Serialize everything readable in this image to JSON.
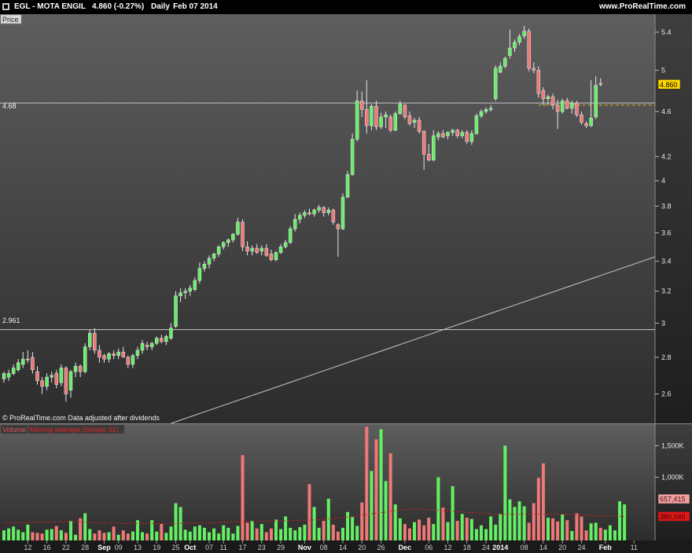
{
  "header": {
    "ticker": "EGL - MOTA ENGIL",
    "quote": "4.860 (-0.27%)",
    "period": "Daily",
    "date": "Feb 07 2014",
    "website": "www.ProRealTime.com"
  },
  "price_panel": {
    "label": "Price",
    "footer": "© ProRealTime.com  Data adjusted after dividends",
    "hline_labels": [
      "4.68",
      "2.961"
    ]
  },
  "volume_panel": {
    "label": "Volume",
    "ma_label": "Moving average (Simple 31)"
  },
  "colors": {
    "up": "#64f064",
    "down": "#f07878",
    "grid": "#c8c8c8",
    "ma": "#cc2222",
    "price_badge": "#ffd700",
    "volume_badge": "#f0a0a0",
    "ma_badge": "#e01818"
  },
  "chart_data": [
    {
      "type": "candlestick",
      "title": "EGL - MOTA ENGIL",
      "period": "Daily",
      "y_scale": "log",
      "ylim": [
        2.45,
        5.6
      ],
      "y_ticks": [
        2.6,
        2.8,
        3,
        3.2,
        3.4,
        3.6,
        3.8,
        4,
        4.2,
        4.6,
        5,
        5.4
      ],
      "x_ticks": [
        "12",
        "16",
        "22",
        "28",
        "Sep",
        "09",
        "13",
        "19",
        "25",
        "Oct",
        "07",
        "11",
        "17",
        "23",
        "29",
        "Nov",
        "08",
        "14",
        "20",
        "26",
        "Dec",
        "06",
        "12",
        "18",
        "24",
        "2014",
        "08",
        "14",
        "20",
        "24",
        "Feb",
        "11"
      ],
      "x_ticks_bold": [
        "Sep",
        "Oct",
        "Nov",
        "Dec",
        "2014",
        "Feb"
      ],
      "horizontal_lines": [
        4.68,
        2.961
      ],
      "trendline": {
        "start": [
          "Oct 11",
          2.45
        ],
        "end": [
          "Feb 12",
          3.43
        ]
      },
      "last_price": 4.86,
      "dashed_level": 4.66,
      "series": [
        {
          "o": 2.68,
          "h": 2.72,
          "l": 2.66,
          "c": 2.71
        },
        {
          "o": 2.69,
          "h": 2.73,
          "l": 2.67,
          "c": 2.71
        },
        {
          "o": 2.71,
          "h": 2.76,
          "l": 2.7,
          "c": 2.74
        },
        {
          "o": 2.73,
          "h": 2.79,
          "l": 2.72,
          "c": 2.77
        },
        {
          "o": 2.76,
          "h": 2.83,
          "l": 2.74,
          "c": 2.79
        },
        {
          "o": 2.79,
          "h": 2.84,
          "l": 2.77,
          "c": 2.79
        },
        {
          "o": 2.8,
          "h": 2.83,
          "l": 2.71,
          "c": 2.73
        },
        {
          "o": 2.72,
          "h": 2.75,
          "l": 2.65,
          "c": 2.67
        },
        {
          "o": 2.67,
          "h": 2.69,
          "l": 2.6,
          "c": 2.64
        },
        {
          "o": 2.64,
          "h": 2.71,
          "l": 2.62,
          "c": 2.69
        },
        {
          "o": 2.69,
          "h": 2.72,
          "l": 2.66,
          "c": 2.7
        },
        {
          "o": 2.71,
          "h": 2.73,
          "l": 2.63,
          "c": 2.65
        },
        {
          "o": 2.66,
          "h": 2.76,
          "l": 2.64,
          "c": 2.74
        },
        {
          "o": 2.74,
          "h": 2.75,
          "l": 2.56,
          "c": 2.6
        },
        {
          "o": 2.62,
          "h": 2.73,
          "l": 2.58,
          "c": 2.72
        },
        {
          "o": 2.72,
          "h": 2.77,
          "l": 2.69,
          "c": 2.75
        },
        {
          "o": 2.75,
          "h": 2.76,
          "l": 2.69,
          "c": 2.72
        },
        {
          "o": 2.72,
          "h": 2.88,
          "l": 2.71,
          "c": 2.86
        },
        {
          "o": 2.86,
          "h": 2.96,
          "l": 2.84,
          "c": 2.94
        },
        {
          "o": 2.94,
          "h": 2.97,
          "l": 2.82,
          "c": 2.84
        },
        {
          "o": 2.84,
          "h": 2.87,
          "l": 2.77,
          "c": 2.8
        },
        {
          "o": 2.81,
          "h": 2.82,
          "l": 2.77,
          "c": 2.79
        },
        {
          "o": 2.79,
          "h": 2.83,
          "l": 2.77,
          "c": 2.82
        },
        {
          "o": 2.82,
          "h": 2.84,
          "l": 2.79,
          "c": 2.81
        },
        {
          "o": 2.81,
          "h": 2.85,
          "l": 2.79,
          "c": 2.83
        },
        {
          "o": 2.83,
          "h": 2.86,
          "l": 2.8,
          "c": 2.8
        },
        {
          "o": 2.8,
          "h": 2.81,
          "l": 2.74,
          "c": 2.76
        },
        {
          "o": 2.76,
          "h": 2.82,
          "l": 2.74,
          "c": 2.81
        },
        {
          "o": 2.81,
          "h": 2.86,
          "l": 2.79,
          "c": 2.84
        },
        {
          "o": 2.84,
          "h": 2.9,
          "l": 2.82,
          "c": 2.88
        },
        {
          "o": 2.87,
          "h": 2.89,
          "l": 2.84,
          "c": 2.86
        },
        {
          "o": 2.86,
          "h": 2.89,
          "l": 2.84,
          "c": 2.88
        },
        {
          "o": 2.88,
          "h": 2.92,
          "l": 2.87,
          "c": 2.91
        },
        {
          "o": 2.91,
          "h": 2.93,
          "l": 2.88,
          "c": 2.89
        },
        {
          "o": 2.89,
          "h": 2.93,
          "l": 2.87,
          "c": 2.92
        },
        {
          "o": 2.91,
          "h": 3.0,
          "l": 2.9,
          "c": 2.97
        },
        {
          "o": 2.98,
          "h": 3.2,
          "l": 2.97,
          "c": 3.17
        },
        {
          "o": 3.17,
          "h": 3.22,
          "l": 3.13,
          "c": 3.19
        },
        {
          "o": 3.19,
          "h": 3.22,
          "l": 3.15,
          "c": 3.2
        },
        {
          "o": 3.2,
          "h": 3.24,
          "l": 3.17,
          "c": 3.22
        },
        {
          "o": 3.21,
          "h": 3.29,
          "l": 3.2,
          "c": 3.27
        },
        {
          "o": 3.27,
          "h": 3.39,
          "l": 3.25,
          "c": 3.35
        },
        {
          "o": 3.35,
          "h": 3.4,
          "l": 3.33,
          "c": 3.38
        },
        {
          "o": 3.38,
          "h": 3.44,
          "l": 3.35,
          "c": 3.42
        },
        {
          "o": 3.42,
          "h": 3.46,
          "l": 3.4,
          "c": 3.45
        },
        {
          "o": 3.45,
          "h": 3.51,
          "l": 3.43,
          "c": 3.5
        },
        {
          "o": 3.5,
          "h": 3.54,
          "l": 3.48,
          "c": 3.53
        },
        {
          "o": 3.53,
          "h": 3.56,
          "l": 3.5,
          "c": 3.55
        },
        {
          "o": 3.55,
          "h": 3.6,
          "l": 3.53,
          "c": 3.59
        },
        {
          "o": 3.59,
          "h": 3.71,
          "l": 3.58,
          "c": 3.68
        },
        {
          "o": 3.68,
          "h": 3.7,
          "l": 3.47,
          "c": 3.5
        },
        {
          "o": 3.5,
          "h": 3.54,
          "l": 3.44,
          "c": 3.47
        },
        {
          "o": 3.47,
          "h": 3.51,
          "l": 3.44,
          "c": 3.49
        },
        {
          "o": 3.49,
          "h": 3.52,
          "l": 3.45,
          "c": 3.46
        },
        {
          "o": 3.47,
          "h": 3.51,
          "l": 3.44,
          "c": 3.49
        },
        {
          "o": 3.49,
          "h": 3.52,
          "l": 3.43,
          "c": 3.44
        },
        {
          "o": 3.45,
          "h": 3.48,
          "l": 3.4,
          "c": 3.41
        },
        {
          "o": 3.41,
          "h": 3.47,
          "l": 3.4,
          "c": 3.46
        },
        {
          "o": 3.46,
          "h": 3.52,
          "l": 3.45,
          "c": 3.5
        },
        {
          "o": 3.5,
          "h": 3.55,
          "l": 3.49,
          "c": 3.53
        },
        {
          "o": 3.53,
          "h": 3.65,
          "l": 3.52,
          "c": 3.63
        },
        {
          "o": 3.63,
          "h": 3.74,
          "l": 3.61,
          "c": 3.7
        },
        {
          "o": 3.7,
          "h": 3.75,
          "l": 3.67,
          "c": 3.73
        },
        {
          "o": 3.73,
          "h": 3.77,
          "l": 3.71,
          "c": 3.75
        },
        {
          "o": 3.75,
          "h": 3.78,
          "l": 3.73,
          "c": 3.74
        },
        {
          "o": 3.74,
          "h": 3.78,
          "l": 3.72,
          "c": 3.77
        },
        {
          "o": 3.77,
          "h": 3.81,
          "l": 3.75,
          "c": 3.79
        },
        {
          "o": 3.79,
          "h": 3.8,
          "l": 3.72,
          "c": 3.75
        },
        {
          "o": 3.75,
          "h": 3.79,
          "l": 3.73,
          "c": 3.77
        },
        {
          "o": 3.77,
          "h": 3.78,
          "l": 3.66,
          "c": 3.68
        },
        {
          "o": 3.66,
          "h": 3.67,
          "l": 3.43,
          "c": 3.63
        },
        {
          "o": 3.63,
          "h": 3.9,
          "l": 3.62,
          "c": 3.87
        },
        {
          "o": 3.87,
          "h": 4.08,
          "l": 3.86,
          "c": 4.05
        },
        {
          "o": 4.05,
          "h": 4.4,
          "l": 4.04,
          "c": 4.35
        },
        {
          "o": 4.35,
          "h": 4.8,
          "l": 4.33,
          "c": 4.7
        },
        {
          "o": 4.7,
          "h": 4.79,
          "l": 4.55,
          "c": 4.62
        },
        {
          "o": 4.62,
          "h": 4.9,
          "l": 4.4,
          "c": 4.47
        },
        {
          "o": 4.47,
          "h": 4.67,
          "l": 4.43,
          "c": 4.65
        },
        {
          "o": 4.65,
          "h": 4.7,
          "l": 4.43,
          "c": 4.46
        },
        {
          "o": 4.46,
          "h": 4.59,
          "l": 4.44,
          "c": 4.55
        },
        {
          "o": 4.55,
          "h": 4.6,
          "l": 4.45,
          "c": 4.57
        },
        {
          "o": 4.55,
          "h": 4.57,
          "l": 4.41,
          "c": 4.43
        },
        {
          "o": 4.43,
          "h": 4.6,
          "l": 4.42,
          "c": 4.58
        },
        {
          "o": 4.58,
          "h": 4.7,
          "l": 4.57,
          "c": 4.67
        },
        {
          "o": 4.66,
          "h": 4.67,
          "l": 4.53,
          "c": 4.55
        },
        {
          "o": 4.56,
          "h": 4.6,
          "l": 4.47,
          "c": 4.49
        },
        {
          "o": 4.5,
          "h": 4.54,
          "l": 4.45,
          "c": 4.52
        },
        {
          "o": 4.52,
          "h": 4.55,
          "l": 4.4,
          "c": 4.42
        },
        {
          "o": 4.42,
          "h": 4.43,
          "l": 4.09,
          "c": 4.22
        },
        {
          "o": 4.22,
          "h": 4.31,
          "l": 4.16,
          "c": 4.17
        },
        {
          "o": 4.17,
          "h": 4.43,
          "l": 4.16,
          "c": 4.38
        },
        {
          "o": 4.37,
          "h": 4.42,
          "l": 4.34,
          "c": 4.4
        },
        {
          "o": 4.4,
          "h": 4.43,
          "l": 4.36,
          "c": 4.37
        },
        {
          "o": 4.38,
          "h": 4.42,
          "l": 4.35,
          "c": 4.41
        },
        {
          "o": 4.41,
          "h": 4.44,
          "l": 4.38,
          "c": 4.43
        },
        {
          "o": 4.43,
          "h": 4.44,
          "l": 4.36,
          "c": 4.38
        },
        {
          "o": 4.38,
          "h": 4.43,
          "l": 4.36,
          "c": 4.41
        },
        {
          "o": 4.41,
          "h": 4.43,
          "l": 4.31,
          "c": 4.33
        },
        {
          "o": 4.33,
          "h": 4.43,
          "l": 4.3,
          "c": 4.4
        },
        {
          "o": 4.4,
          "h": 4.58,
          "l": 4.39,
          "c": 4.56
        },
        {
          "o": 4.56,
          "h": 4.62,
          "l": 4.54,
          "c": 4.6
        },
        {
          "o": 4.6,
          "h": 4.64,
          "l": 4.58,
          "c": 4.62
        },
        {
          "o": 4.62,
          "h": 4.66,
          "l": 4.6,
          "c": 4.63
        },
        {
          "o": 4.72,
          "h": 5.05,
          "l": 4.7,
          "c": 5.02
        },
        {
          "o": 4.98,
          "h": 5.08,
          "l": 4.97,
          "c": 5.04
        },
        {
          "o": 5.04,
          "h": 5.14,
          "l": 5.02,
          "c": 5.12
        },
        {
          "o": 5.15,
          "h": 5.43,
          "l": 5.12,
          "c": 5.23
        },
        {
          "o": 5.23,
          "h": 5.32,
          "l": 5.19,
          "c": 5.29
        },
        {
          "o": 5.29,
          "h": 5.38,
          "l": 5.26,
          "c": 5.35
        },
        {
          "o": 5.36,
          "h": 5.47,
          "l": 5.33,
          "c": 5.41
        },
        {
          "o": 5.41,
          "h": 5.44,
          "l": 4.99,
          "c": 5.02
        },
        {
          "o": 5.02,
          "h": 5.08,
          "l": 4.97,
          "c": 5.0
        },
        {
          "o": 5.0,
          "h": 5.04,
          "l": 4.73,
          "c": 4.77
        },
        {
          "o": 4.8,
          "h": 4.83,
          "l": 4.66,
          "c": 4.72
        },
        {
          "o": 4.72,
          "h": 4.76,
          "l": 4.66,
          "c": 4.74
        },
        {
          "o": 4.74,
          "h": 4.77,
          "l": 4.62,
          "c": 4.66
        },
        {
          "o": 4.66,
          "h": 4.71,
          "l": 4.44,
          "c": 4.6
        },
        {
          "o": 4.6,
          "h": 4.72,
          "l": 4.58,
          "c": 4.7
        },
        {
          "o": 4.7,
          "h": 4.73,
          "l": 4.62,
          "c": 4.63
        },
        {
          "o": 4.63,
          "h": 4.7,
          "l": 4.58,
          "c": 4.68
        },
        {
          "o": 4.68,
          "h": 4.7,
          "l": 4.55,
          "c": 4.57
        },
        {
          "o": 4.57,
          "h": 4.6,
          "l": 4.48,
          "c": 4.5
        },
        {
          "o": 4.49,
          "h": 4.51,
          "l": 4.45,
          "c": 4.47
        },
        {
          "o": 4.47,
          "h": 4.9,
          "l": 4.46,
          "c": 4.54
        },
        {
          "o": 4.55,
          "h": 4.94,
          "l": 4.53,
          "c": 4.85
        },
        {
          "o": 4.87,
          "h": 4.92,
          "l": 4.84,
          "c": 4.86
        }
      ]
    },
    {
      "type": "bar",
      "title": "Volume",
      "y_ticks": [
        "1,000K",
        "1,500K"
      ],
      "ylim": [
        0,
        1840000
      ],
      "last_volume": "657,415",
      "last_ma": "380,040",
      "volume": [
        160000,
        190000,
        220000,
        170000,
        130000,
        250000,
        130000,
        120000,
        110000,
        170000,
        180000,
        230000,
        160000,
        120000,
        310000,
        90000,
        350000,
        430000,
        180000,
        110000,
        160000,
        120000,
        130000,
        220000,
        90000,
        160000,
        110000,
        140000,
        320000,
        130000,
        110000,
        320000,
        140000,
        260000,
        120000,
        220000,
        590000,
        530000,
        170000,
        140000,
        220000,
        240000,
        200000,
        130000,
        190000,
        110000,
        240000,
        200000,
        110000,
        230000,
        1350000,
        280000,
        310000,
        190000,
        260000,
        130000,
        190000,
        330000,
        180000,
        380000,
        200000,
        160000,
        210000,
        250000,
        890000,
        530000,
        200000,
        310000,
        660000,
        250000,
        140000,
        200000,
        450000,
        370000,
        230000,
        600000,
        1800000,
        1100000,
        1600000,
        1760000,
        940000,
        1380000,
        570000,
        350000,
        260000,
        190000,
        290000,
        330000,
        240000,
        360000,
        260000,
        1000000,
        520000,
        290000,
        860000,
        310000,
        420000,
        360000,
        340000,
        180000,
        240000,
        180000,
        380000,
        250000,
        420000,
        1500000,
        650000,
        530000,
        620000,
        540000,
        280000,
        590000,
        990000,
        1220000,
        360000,
        350000,
        300000,
        410000,
        320000,
        150000,
        430000,
        380000,
        160000,
        270000,
        280000,
        200000,
        170000,
        240000,
        160000,
        620000,
        570000
      ],
      "moving_average_31": [
        275000,
        275000,
        278000,
        280000,
        282000,
        284000,
        286000,
        288000,
        290000,
        292000,
        294000,
        296000,
        298000,
        300000,
        300000,
        300000,
        295000,
        290000,
        285000,
        280000,
        278000,
        276000,
        274000,
        272000,
        270000,
        268000,
        268000,
        268000,
        268000,
        268000,
        268000,
        268000,
        268000,
        268000,
        268000,
        268000,
        268000,
        268000,
        270000,
        272000,
        274000,
        276000,
        278000,
        280000,
        282000,
        284000,
        286000,
        288000,
        290000,
        292000,
        294000,
        296000,
        298000,
        300000,
        302000,
        304000,
        306000,
        308000,
        310000,
        312000,
        314000,
        316000,
        318000,
        320000,
        322000,
        325000,
        330000,
        335000,
        340000,
        345000,
        350000,
        360000,
        370000,
        380000,
        390000,
        400000,
        410000,
        420000,
        430000,
        440000,
        450000,
        460000,
        470000,
        480000,
        490000,
        500000,
        500000,
        495000,
        490000,
        485000,
        480000,
        475000,
        470000,
        465000,
        460000,
        455000,
        450000,
        445000,
        440000,
        435000,
        430000,
        425000,
        420000,
        415000,
        415000,
        415000,
        415000,
        415000,
        415000,
        415000,
        415000,
        415000,
        415000,
        415000,
        415000,
        415000,
        415000,
        415000,
        415000,
        412000,
        408000,
        404000,
        400000,
        396000,
        392000,
        388000,
        384000,
        380000,
        380000,
        380000,
        380000
      ]
    }
  ]
}
